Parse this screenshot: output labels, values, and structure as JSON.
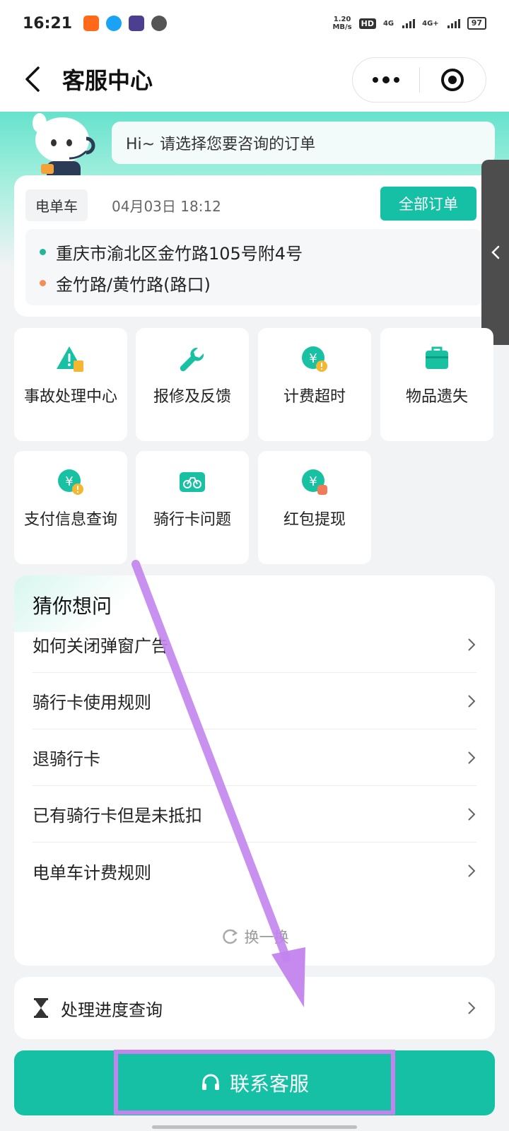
{
  "status_bar": {
    "time": "16:21",
    "net_speed_top": "1.20",
    "net_speed_unit": "MB/s",
    "hd": "HD",
    "sig1": "4G",
    "sig2": "4G+",
    "battery": "97"
  },
  "nav": {
    "title": "客服中心"
  },
  "greeting": "Hi~ 请选择您要咨询的订单",
  "order": {
    "type": "电单车",
    "time": "04月03日 18:12",
    "all_orders_label": "全部订单",
    "start": "重庆市渝北区金竹路105号附4号",
    "end": "金竹路/黄竹路(路口)"
  },
  "grid": {
    "items": [
      {
        "label": "事故处理中心",
        "icon": "warning-icon"
      },
      {
        "label": "报修及反馈",
        "icon": "wrench-icon"
      },
      {
        "label": "计费超时",
        "icon": "yuan-alert-icon"
      },
      {
        "label": "物品遗失",
        "icon": "bag-icon"
      },
      {
        "label": "支付信息查询",
        "icon": "yuan-alert-icon"
      },
      {
        "label": "骑行卡问题",
        "icon": "bike-card-icon"
      },
      {
        "label": "红包提现",
        "icon": "yuan-coin-icon"
      }
    ]
  },
  "guess": {
    "title": "猜你想问",
    "questions": [
      "如何关闭弹窗广告",
      "骑行卡使用规则",
      "退骑行卡",
      "已有骑行卡但是未抵扣",
      "电单车计费规则"
    ],
    "refresh_label": "换一换"
  },
  "progress": {
    "label": "处理进度查询"
  },
  "contact": {
    "label": "联系客服"
  },
  "colors": {
    "accent": "#16c0a5",
    "annotation": "#c384ee"
  }
}
